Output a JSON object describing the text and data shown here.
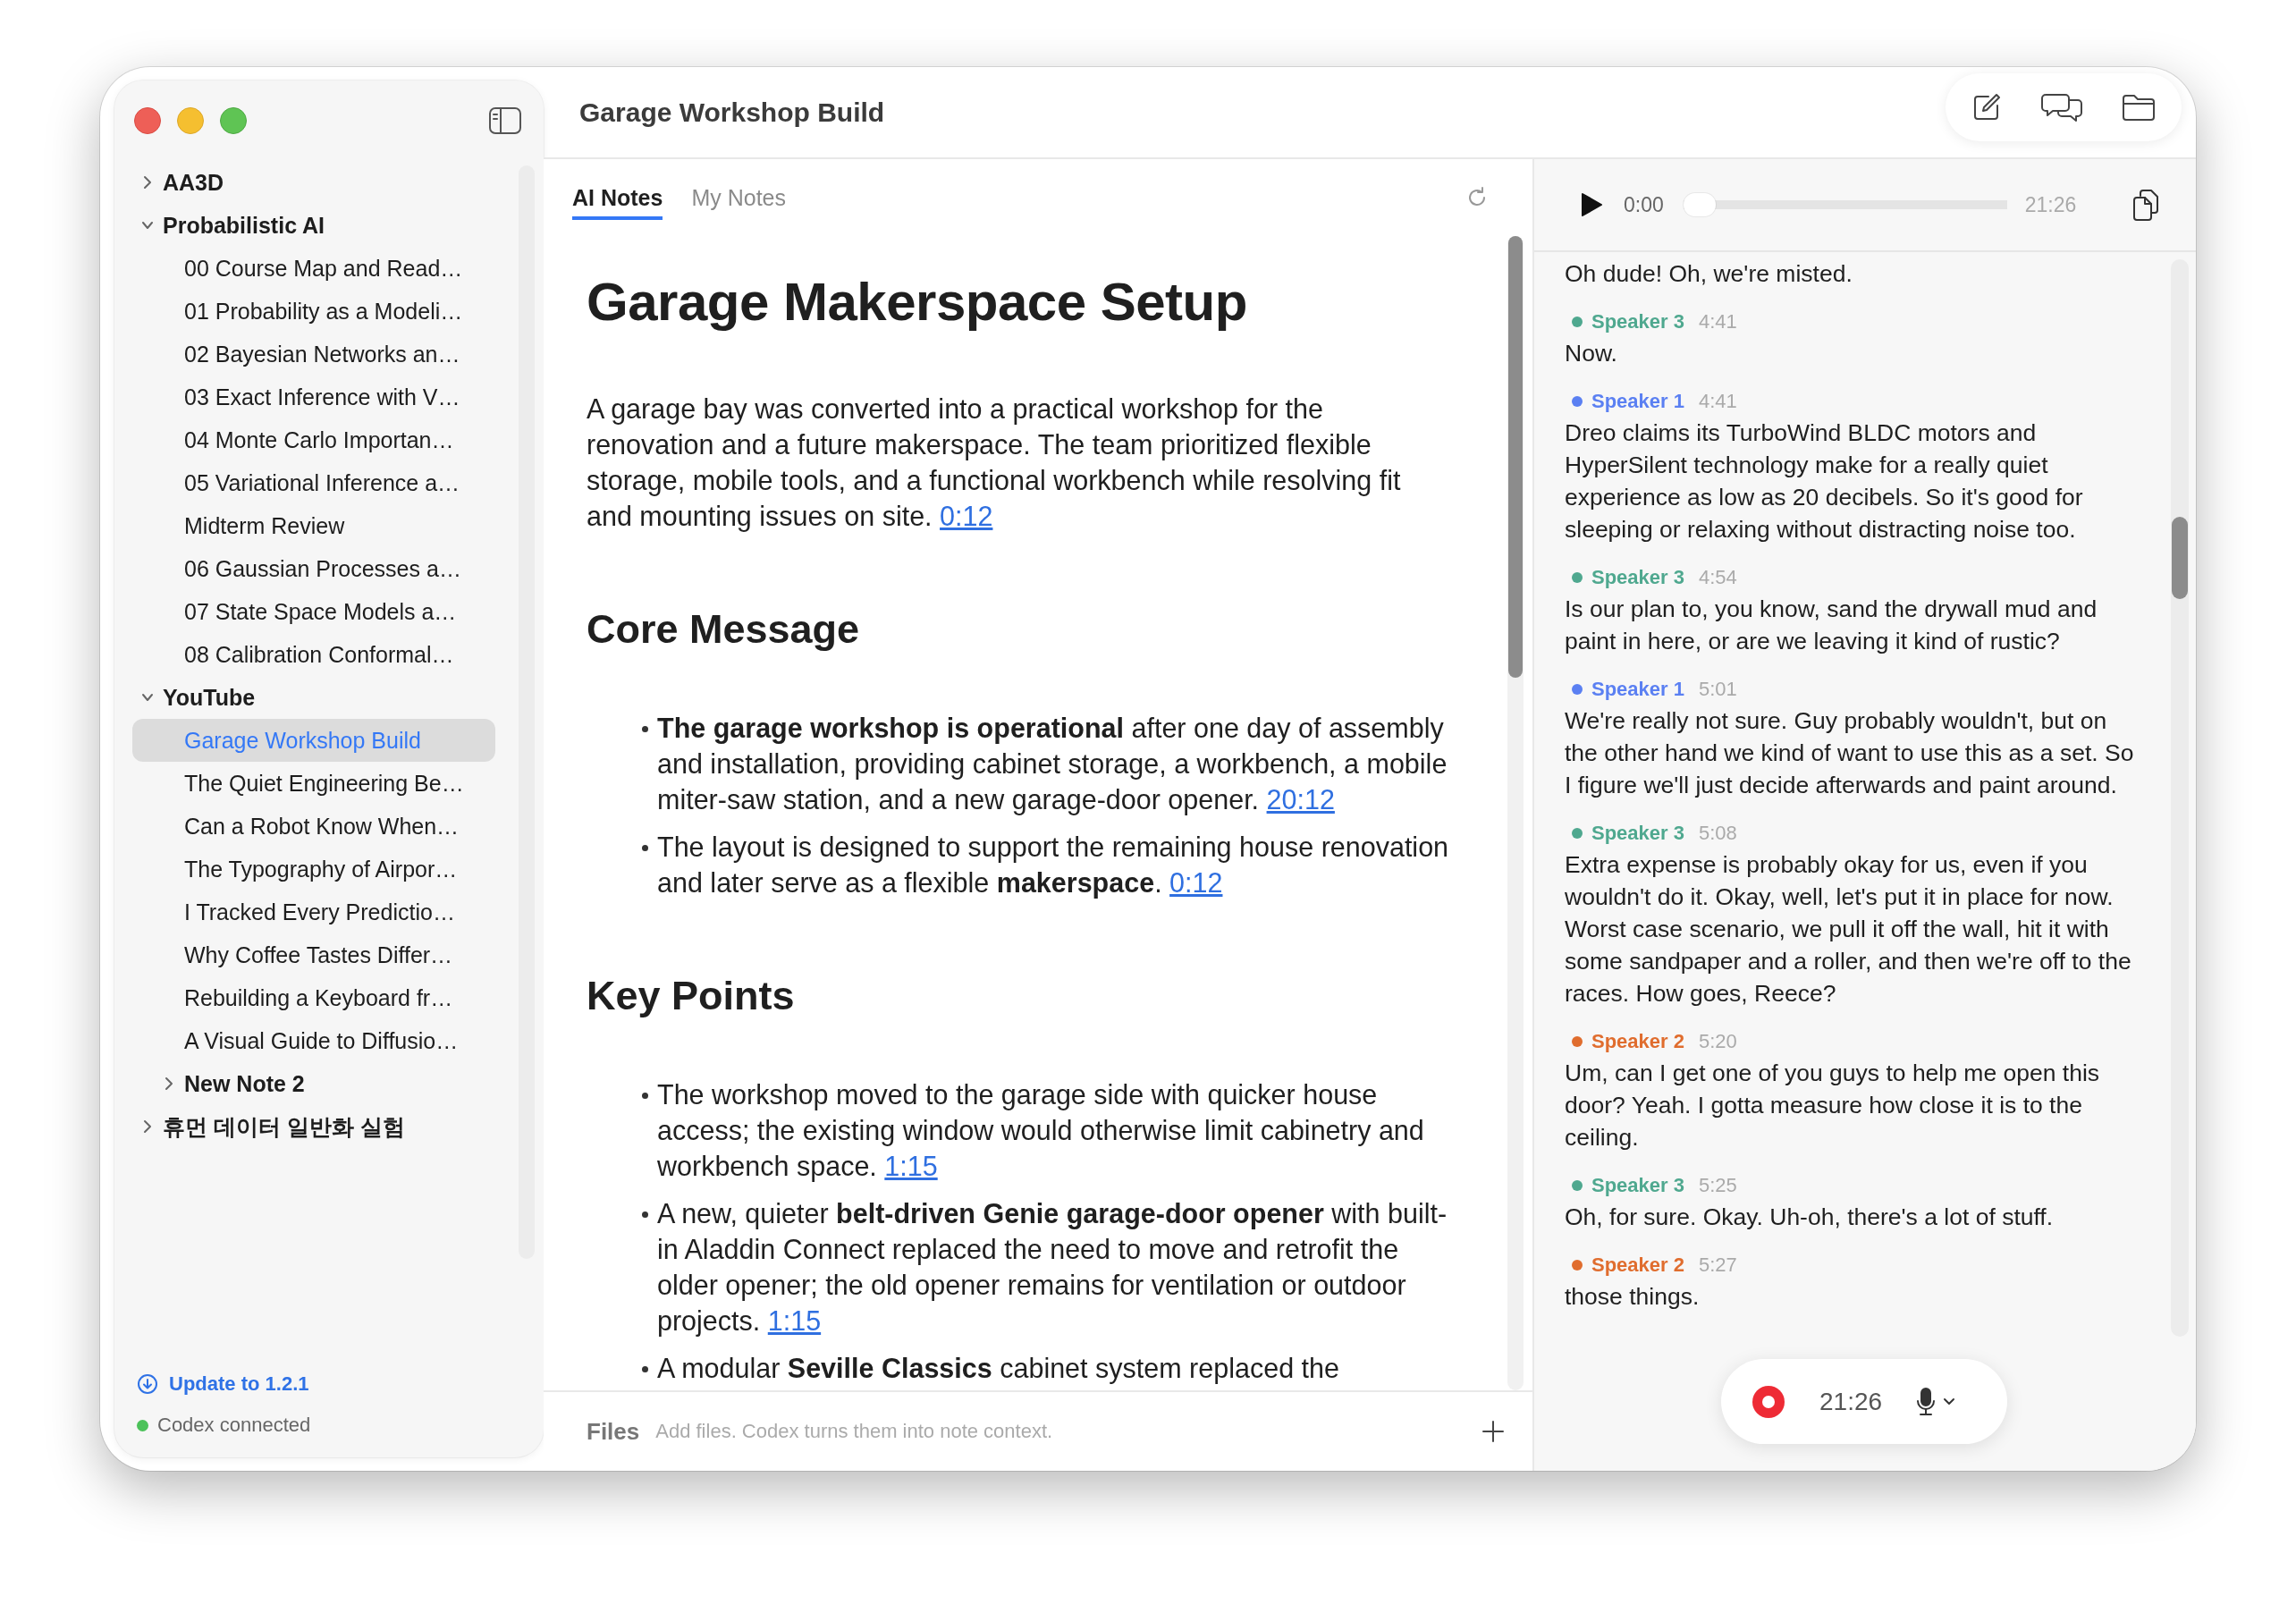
{
  "window": {
    "title": "Garage Workshop Build"
  },
  "sidebar": {
    "tree": [
      {
        "kind": "folder",
        "label": "AA3D",
        "expanded": false
      },
      {
        "kind": "folder",
        "label": "Probabilistic AI",
        "expanded": true,
        "children": [
          {
            "kind": "note",
            "label": "00 Course Map and Read…",
            "selected": false
          },
          {
            "kind": "note",
            "label": "01 Probability as a Modeli…",
            "selected": false
          },
          {
            "kind": "note",
            "label": "02 Bayesian Networks an…",
            "selected": false
          },
          {
            "kind": "note",
            "label": "03 Exact Inference with V…",
            "selected": false
          },
          {
            "kind": "note",
            "label": "04 Monte Carlo Importan…",
            "selected": false
          },
          {
            "kind": "note",
            "label": "05 Variational Inference a…",
            "selected": false
          },
          {
            "kind": "note",
            "label": "Midterm Review",
            "selected": false
          },
          {
            "kind": "note",
            "label": "06 Gaussian Processes a…",
            "selected": false
          },
          {
            "kind": "note",
            "label": "07 State Space Models a…",
            "selected": false
          },
          {
            "kind": "note",
            "label": "08 Calibration Conformal…",
            "selected": false
          }
        ]
      },
      {
        "kind": "folder",
        "label": "YouTube",
        "expanded": true,
        "children": [
          {
            "kind": "note",
            "label": "Garage Workshop Build",
            "selected": true
          },
          {
            "kind": "note",
            "label": "The Quiet Engineering Be…",
            "selected": false
          },
          {
            "kind": "note",
            "label": "Can a Robot Know When…",
            "selected": false
          },
          {
            "kind": "note",
            "label": "The Typography of Airpor…",
            "selected": false
          },
          {
            "kind": "note",
            "label": "I Tracked Every Predictio…",
            "selected": false
          },
          {
            "kind": "note",
            "label": "Why Coffee Tastes Differ…",
            "selected": false
          },
          {
            "kind": "note",
            "label": "Rebuilding a Keyboard fr…",
            "selected": false
          },
          {
            "kind": "note",
            "label": "A Visual Guide to Diffusio…",
            "selected": false
          },
          {
            "kind": "folder",
            "label": "New Note 2",
            "expanded": false
          }
        ]
      },
      {
        "kind": "folder",
        "label": "휴먼 데이터 일반화 실험",
        "expanded": false
      }
    ],
    "update_link": "Update to 1.2.1",
    "status": {
      "label": "Codex connected",
      "connected": true
    }
  },
  "notes": {
    "tabs": [
      {
        "label": "AI Notes",
        "selected": true
      },
      {
        "label": "My Notes",
        "selected": false
      }
    ],
    "title": "Garage Makerspace Setup",
    "summary": {
      "text": "A garage bay was converted into a practical workshop for the renovation and a future makerspace. The team prioritized flexible storage, mobile tools, and a functional workbench while resolving fit and mounting issues on site.",
      "timestamp": "0:12"
    },
    "sections": [
      {
        "heading": "Core Message",
        "bullets": [
          {
            "text": "**The garage workshop is operational** after one day of assembly and installation, providing cabinet storage, a workbench, a mobile miter-saw station, and a new garage-door opener.",
            "timestamp": "20:12"
          },
          {
            "text": "The layout is designed to support the remaining house renovation and later serve as a flexible **makerspace**.",
            "timestamp": "0:12"
          }
        ]
      },
      {
        "heading": "Key Points",
        "bullets": [
          {
            "text": "The workshop moved to the garage side with quicker house access; the existing window would otherwise limit cabinetry and workbench space.",
            "timestamp": "1:15"
          },
          {
            "text": "A new, quieter **belt-driven Genie garage-door opener** with built-in Aladdin Connect replaced the need to move and retrofit the older opener; the old opener remains for ventilation or outdoor projects.",
            "timestamp": "1:15"
          },
          {
            "text": "A modular **Seville Classics** cabinet system replaced the"
          }
        ]
      }
    ]
  },
  "files": {
    "label": "Files",
    "placeholder": "Add files. Codex turns them into note context."
  },
  "player": {
    "position": "0:00",
    "duration": "21:26",
    "level": 0
  },
  "transcript": [
    {
      "text": "Oh dude! Oh, we're misted."
    },
    {
      "speaker": "Speaker 3",
      "time": "4:41",
      "color": "#4fa88f",
      "text": "Now."
    },
    {
      "speaker": "Speaker 1",
      "time": "4:41",
      "color": "#5b80f2",
      "text": "Dreo claims its TurboWind BLDC motors and HyperSilent technology make for a really quiet experience as low as 20 decibels. So it's good for sleeping or relaxing without distracting noise too."
    },
    {
      "speaker": "Speaker 3",
      "time": "4:54",
      "color": "#4fa88f",
      "text": "Is our plan to, you know, sand the drywall mud and paint in here, or are we leaving it kind of rustic?"
    },
    {
      "speaker": "Speaker 1",
      "time": "5:01",
      "color": "#5b80f2",
      "text": "We're really not sure. Guy probably wouldn't, but on the other hand we kind of want to use this as a set. So I figure we'll just decide afterwards and paint around."
    },
    {
      "speaker": "Speaker 3",
      "time": "5:08",
      "color": "#4fa88f",
      "text": "Extra expense is probably okay for us, even if you wouldn't do it. Okay, well, let's put it in place for now. Worst case scenario, we pull it off the wall, hit it with some sandpaper and a roller, and then we're off to the races. How goes, Reece?"
    },
    {
      "speaker": "Speaker 2",
      "time": "5:20",
      "color": "#e06d2e",
      "text": "Um, can I get one of you guys to help me open this door? Yeah. I gotta measure how close it is to the ceiling."
    },
    {
      "speaker": "Speaker 3",
      "time": "5:25",
      "color": "#4fa88f",
      "text": "Oh, for sure. Okay. Uh-oh, there's a lot of stuff."
    },
    {
      "speaker": "Speaker 2",
      "time": "5:27",
      "color": "#e06d2e",
      "text": "those things."
    }
  ],
  "recorder": {
    "elapsed": "21:26",
    "recording": true
  }
}
